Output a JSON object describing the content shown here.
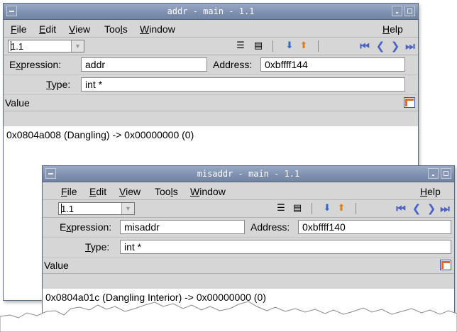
{
  "windows": [
    {
      "title": "addr - main - 1.1",
      "menu": [
        {
          "label": "File",
          "key": "F",
          "rest": "ile"
        },
        {
          "label": "Edit",
          "key": "E",
          "rest": "dit"
        },
        {
          "label": "View",
          "key": "V",
          "rest": "iew"
        },
        {
          "label": "Tools",
          "pre": "Too",
          "key": "l",
          "rest": "s"
        },
        {
          "label": "Window",
          "key": "W",
          "rest": "indow"
        },
        {
          "label": "Help",
          "key": "H",
          "rest": "elp"
        }
      ],
      "thread_combo": {
        "value": "1.1"
      },
      "expression": {
        "label_key": "x",
        "label_pre": "E",
        "label_rest": "pression:",
        "value": "addr"
      },
      "address": {
        "label": "Address:",
        "value": "0xbffff144"
      },
      "type": {
        "label_key": "T",
        "label_rest": "ype:",
        "value": "int *"
      },
      "value_header": "Value",
      "value_line": "0x0804a008 (Dangling) -> 0x00000000 (0)"
    },
    {
      "title": "misaddr - main - 1.1",
      "menu": [
        {
          "label": "File",
          "key": "F",
          "rest": "ile"
        },
        {
          "label": "Edit",
          "key": "E",
          "rest": "dit"
        },
        {
          "label": "View",
          "key": "V",
          "rest": "iew"
        },
        {
          "label": "Tools",
          "pre": "Too",
          "key": "l",
          "rest": "s"
        },
        {
          "label": "Window",
          "key": "W",
          "rest": "indow"
        },
        {
          "label": "Help",
          "key": "H",
          "rest": "elp"
        }
      ],
      "thread_combo": {
        "value": "1.1"
      },
      "expression": {
        "label_key": "x",
        "label_pre": "E",
        "label_rest": "pression:",
        "value": "misaddr"
      },
      "address": {
        "label": "Address:",
        "value": "0xbffff140"
      },
      "type": {
        "label_key": "T",
        "label_rest": "ype:",
        "value": "int *"
      },
      "value_header": "Value",
      "value_line": "0x0804a01c (Dangling Interior) -> 0x00000000 (0)"
    }
  ],
  "icons": {
    "toolbar": [
      "list-view-icon",
      "detail-view-icon",
      "dive-in-icon",
      "dive-out-icon",
      "first-icon",
      "previous-icon",
      "next-icon",
      "last-icon"
    ],
    "colors": {
      "nav": "#4b62c6",
      "dive_green": "#2e9a2e",
      "dive_orange": "#e07a1a",
      "title_bar": "#7d8fb0"
    }
  }
}
